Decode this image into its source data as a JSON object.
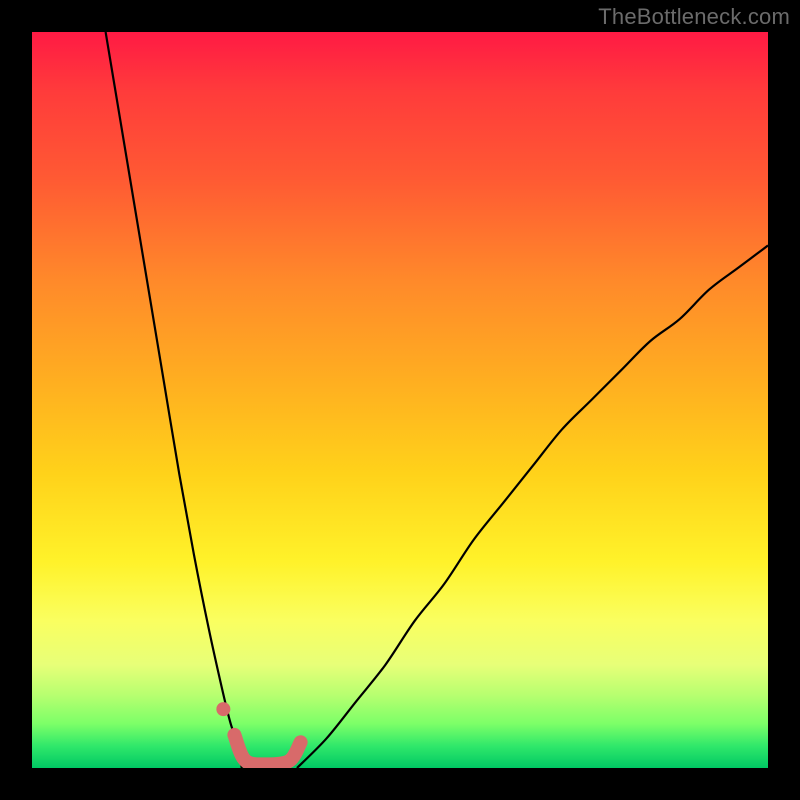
{
  "watermark": "TheBottleneck.com",
  "chart_data": {
    "type": "line",
    "title": "",
    "xlabel": "",
    "ylabel": "",
    "xlim": [
      0,
      100
    ],
    "ylim": [
      0,
      100
    ],
    "grid": false,
    "legend": false,
    "background_gradient": {
      "direction": "top-to-bottom",
      "stops": [
        {
          "pos": 0.0,
          "color": "#ff1a44"
        },
        {
          "pos": 0.08,
          "color": "#ff3b3b"
        },
        {
          "pos": 0.2,
          "color": "#ff5a33"
        },
        {
          "pos": 0.34,
          "color": "#ff8a2a"
        },
        {
          "pos": 0.48,
          "color": "#ffb020"
        },
        {
          "pos": 0.6,
          "color": "#ffd21a"
        },
        {
          "pos": 0.72,
          "color": "#fff22a"
        },
        {
          "pos": 0.8,
          "color": "#faff60"
        },
        {
          "pos": 0.86,
          "color": "#e7ff78"
        },
        {
          "pos": 0.9,
          "color": "#b8ff70"
        },
        {
          "pos": 0.94,
          "color": "#7cff68"
        },
        {
          "pos": 0.97,
          "color": "#30e86a"
        },
        {
          "pos": 1.0,
          "color": "#00c864"
        }
      ]
    },
    "series": [
      {
        "name": "left-descending-curve",
        "stroke": "#000000",
        "x": [
          10,
          12,
          14,
          16,
          18,
          20,
          22,
          24,
          26,
          27,
          28,
          28.5
        ],
        "y": [
          100,
          88,
          76,
          64,
          52,
          40,
          29,
          19,
          10,
          6,
          3,
          0
        ]
      },
      {
        "name": "right-ascending-curve",
        "stroke": "#000000",
        "x": [
          36,
          40,
          44,
          48,
          52,
          56,
          60,
          64,
          68,
          72,
          76,
          80,
          84,
          88,
          92,
          96,
          100
        ],
        "y": [
          0,
          4,
          9,
          14,
          20,
          25,
          31,
          36,
          41,
          46,
          50,
          54,
          58,
          61,
          65,
          68,
          71
        ]
      },
      {
        "name": "bottom-markers",
        "stroke": "#d86a6a",
        "style": "thick-rounded",
        "x": [
          27.5,
          29,
          32,
          35,
          36.5
        ],
        "y": [
          4.5,
          1,
          0.5,
          1,
          3.5
        ]
      }
    ],
    "markers": [
      {
        "name": "isolated-dot",
        "x": 26,
        "y": 8,
        "color": "#d86a6a"
      }
    ]
  }
}
